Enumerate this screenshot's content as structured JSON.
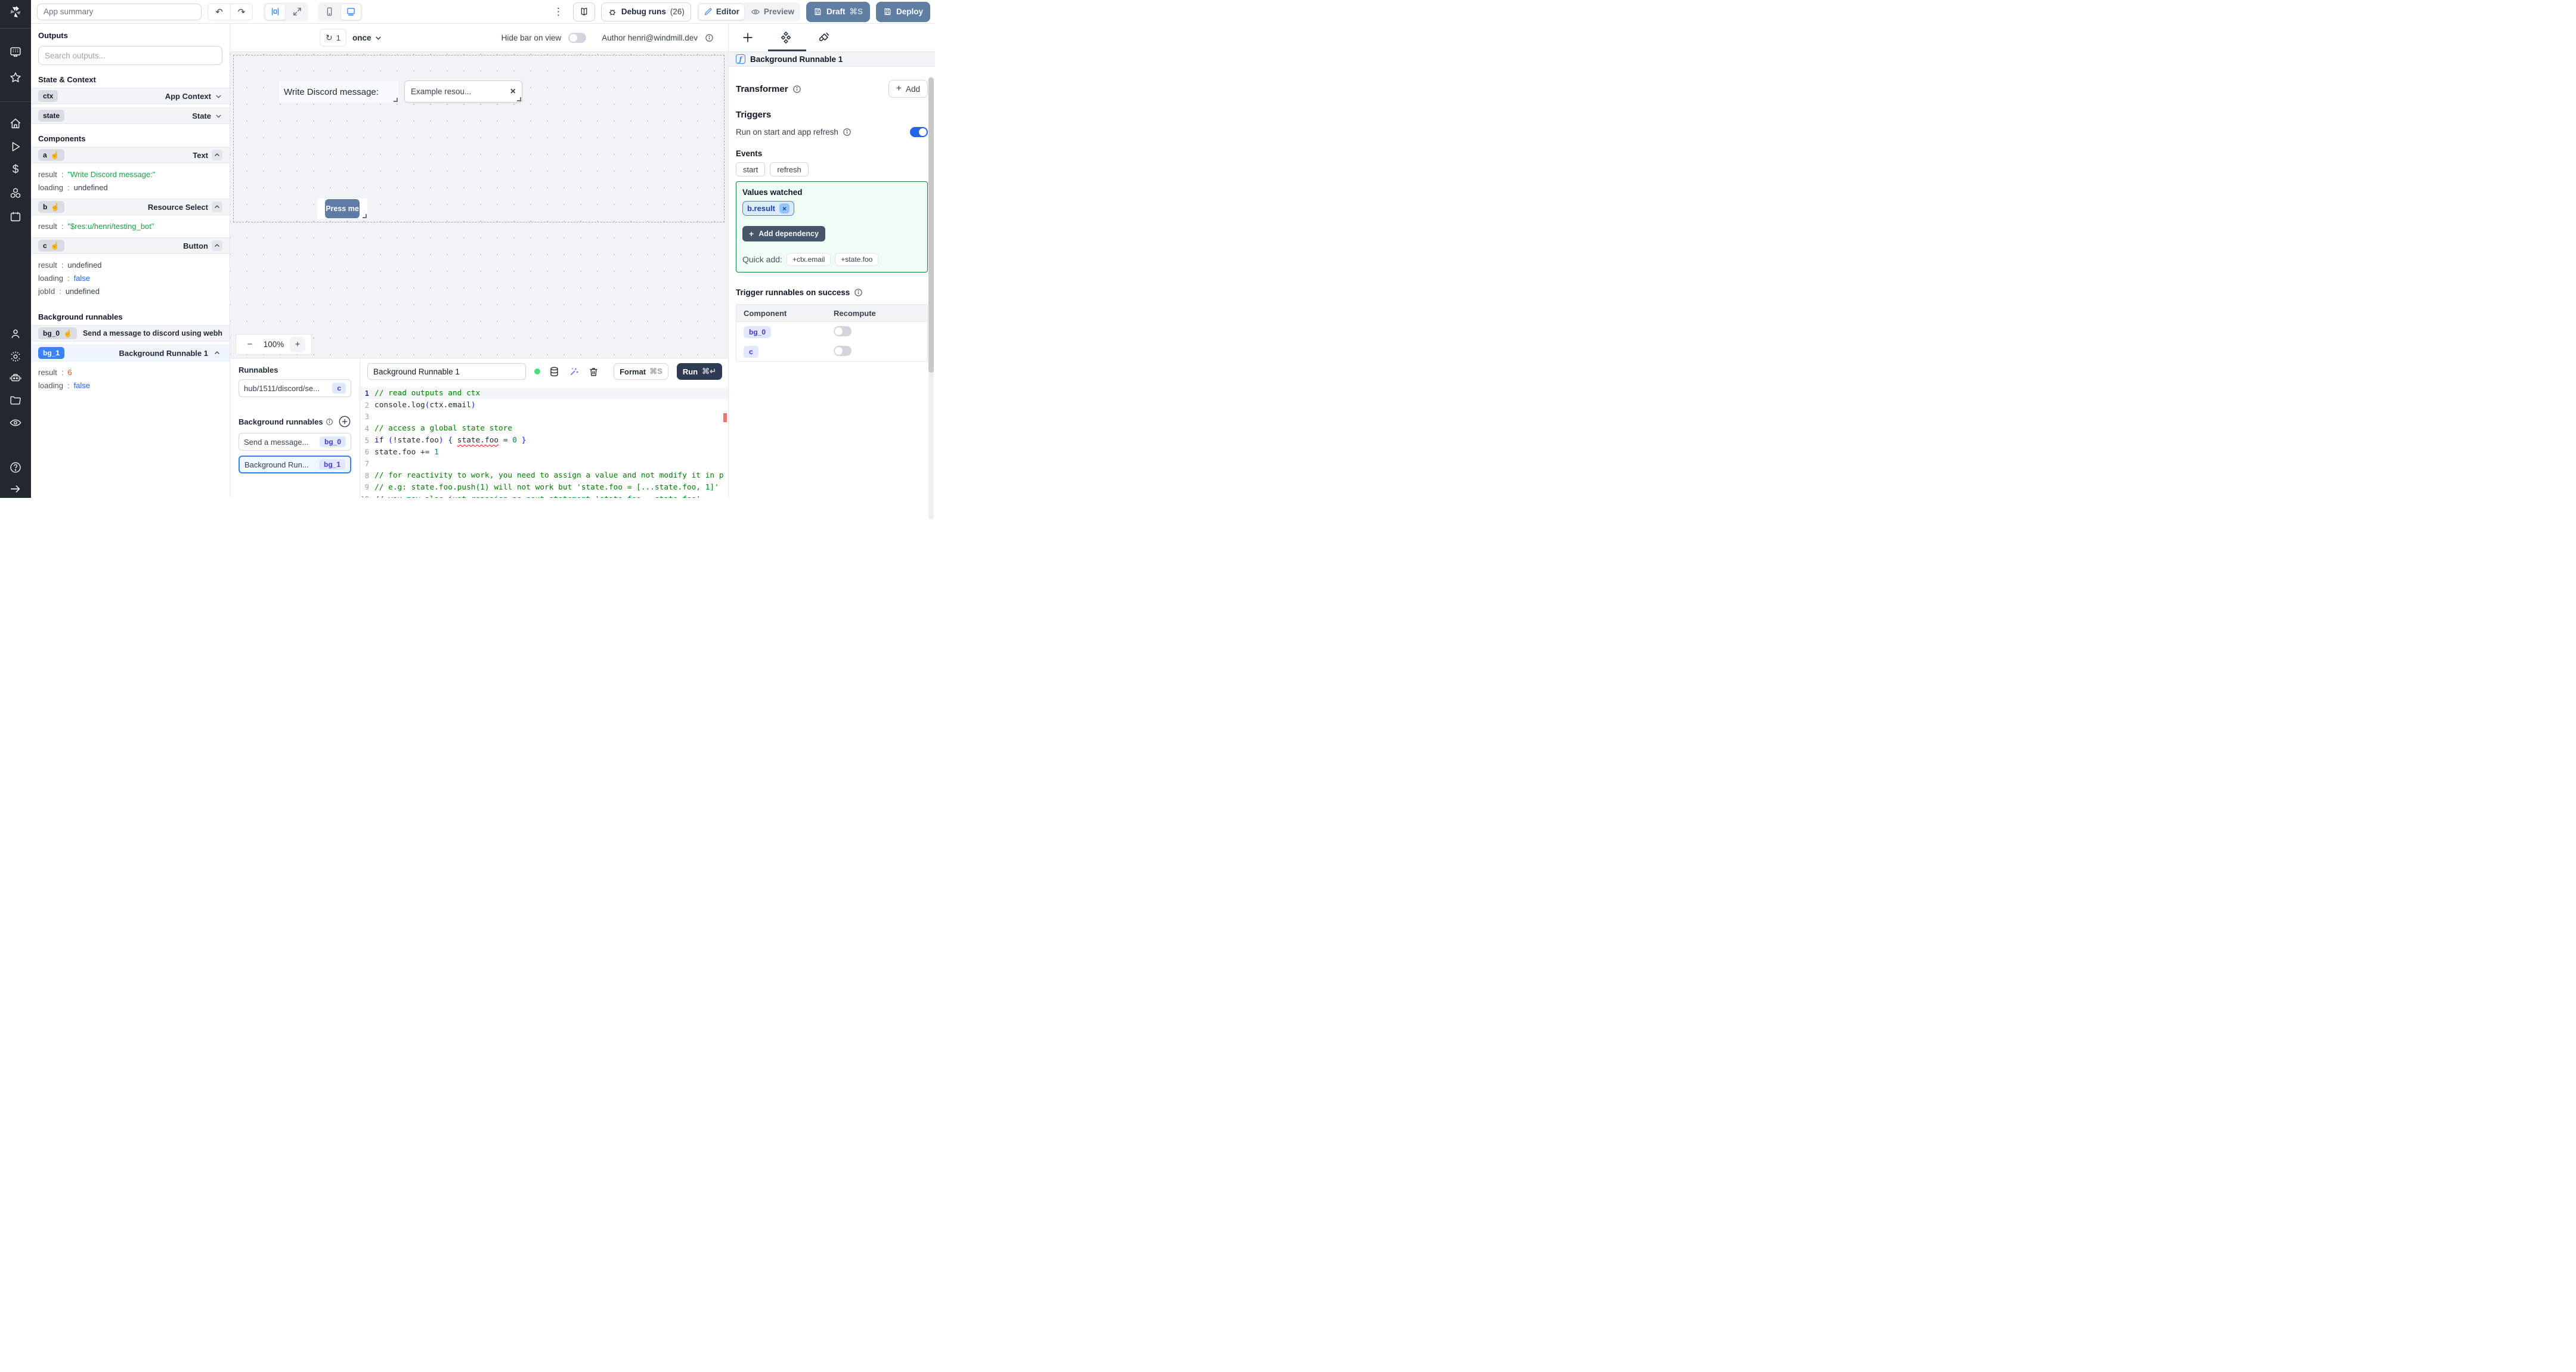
{
  "topbar": {
    "app_summary_placeholder": "App summary",
    "debug_runs_label": "Debug runs",
    "debug_runs_count": "(26)",
    "editor_label": "Editor",
    "preview_label": "Preview",
    "draft_label": "Draft",
    "draft_shortcut": "⌘S",
    "deploy_label": "Deploy"
  },
  "canvas_header": {
    "refresh_count": "1",
    "mode": "once",
    "hide_bar_label": "Hide bar on view",
    "author_label": "Author henri@windmill.dev"
  },
  "outputs": {
    "title": "Outputs",
    "search_placeholder": "Search outputs...",
    "state_context_label": "State & Context",
    "ctx_badge": "ctx",
    "ctx_type": "App Context",
    "state_badge": "state",
    "state_type": "State",
    "components_label": "Components",
    "a_badge": "a",
    "a_type": "Text",
    "a_rows": [
      {
        "k": "result",
        "v": "\"Write Discord message:\""
      },
      {
        "k": "loading",
        "v": "undefined"
      }
    ],
    "b_badge": "b",
    "b_type": "Resource Select",
    "b_rows": [
      {
        "k": "result",
        "v": "\"$res:u/henri/testing_bot\""
      }
    ],
    "c_badge": "c",
    "c_type": "Button",
    "c_rows": [
      {
        "k": "result",
        "v": "undefined"
      },
      {
        "k": "loading",
        "v": "false"
      },
      {
        "k": "jobId",
        "v": "undefined"
      }
    ],
    "background_label": "Background runnables",
    "bg0_badge": "bg_0",
    "bg0_name": "Send a message to discord using webhoo",
    "bg1_badge": "bg_1",
    "bg1_name": "Background Runnable 1",
    "bg1_rows": [
      {
        "k": "result",
        "v": "6"
      },
      {
        "k": "loading",
        "v": "false"
      }
    ]
  },
  "canvas": {
    "text_component": "Write Discord message:",
    "select_value": "Example resou...",
    "select_clear": "×",
    "button_label": "Press me",
    "zoom_value": "100%",
    "zoom_minus": "−",
    "zoom_plus": "+"
  },
  "runnables_panel": {
    "title": "Runnables",
    "item_hub_name": "hub/1511/discord/se...",
    "item_hub_badge": "c",
    "background_title": "Background runnables",
    "item_bg0_name": "Send a message...",
    "item_bg0_badge": "bg_0",
    "item_bg1_name": "Background Run...",
    "item_bg1_badge": "bg_1"
  },
  "editor": {
    "name": "Background Runnable 1",
    "format_label": "Format",
    "format_shortcut": "⌘S",
    "run_label": "Run",
    "run_shortcut": "⌘↵",
    "code_lines": [
      [
        [
          "comment",
          "// read outputs and ctx"
        ]
      ],
      [
        [
          "plain",
          "console.log"
        ],
        [
          "bracket",
          "("
        ],
        [
          "plain",
          "ctx.email"
        ],
        [
          "bracket",
          ")"
        ]
      ],
      [],
      [
        [
          "comment",
          "// access a global state store"
        ]
      ],
      [
        [
          "kw",
          "if"
        ],
        [
          "plain",
          " "
        ],
        [
          "bracket",
          "("
        ],
        [
          "plain",
          "!state.foo"
        ],
        [
          "bracket",
          ")"
        ],
        [
          "plain",
          " "
        ],
        [
          "bracket",
          "{"
        ],
        [
          "plain",
          " "
        ],
        [
          "sq",
          "state.foo"
        ],
        [
          "plain",
          " = "
        ],
        [
          "num",
          "0"
        ],
        [
          "plain",
          " "
        ],
        [
          "bracket",
          "}"
        ]
      ],
      [
        [
          "plain",
          "state.foo += "
        ],
        [
          "num",
          "1"
        ]
      ],
      [],
      [
        [
          "comment",
          "// for reactivity to work, you need to assign a value and not modify it in p"
        ]
      ],
      [
        [
          "comment",
          "// e.g: state.foo.push(1) will not work but 'state.foo = [...state.foo, 1]'"
        ]
      ],
      [
        [
          "comment",
          "// you may also just reassign as next statement 'state.foo = state.foo'"
        ]
      ]
    ]
  },
  "right_panel": {
    "header_title": "Background Runnable 1",
    "fn_glyph": "ƒ",
    "transformer_label": "Transformer",
    "add_label": "Add",
    "triggers_label": "Triggers",
    "run_on_start_label": "Run on start and app refresh",
    "events_label": "Events",
    "event_chips": [
      "start",
      "refresh"
    ],
    "values_watched_label": "Values watched",
    "watched_chip": "b.result",
    "watched_chip_close": "×",
    "add_dependency_label": "Add dependency",
    "quick_add_label": "Quick add:",
    "quick_chips": [
      "+ctx.email",
      "+state.foo"
    ],
    "trigger_success_label": "Trigger runnables on success",
    "table_headers": [
      "Component",
      "Recompute"
    ],
    "table_rows": [
      {
        "badge": "bg_0"
      },
      {
        "badge": "c"
      }
    ]
  }
}
